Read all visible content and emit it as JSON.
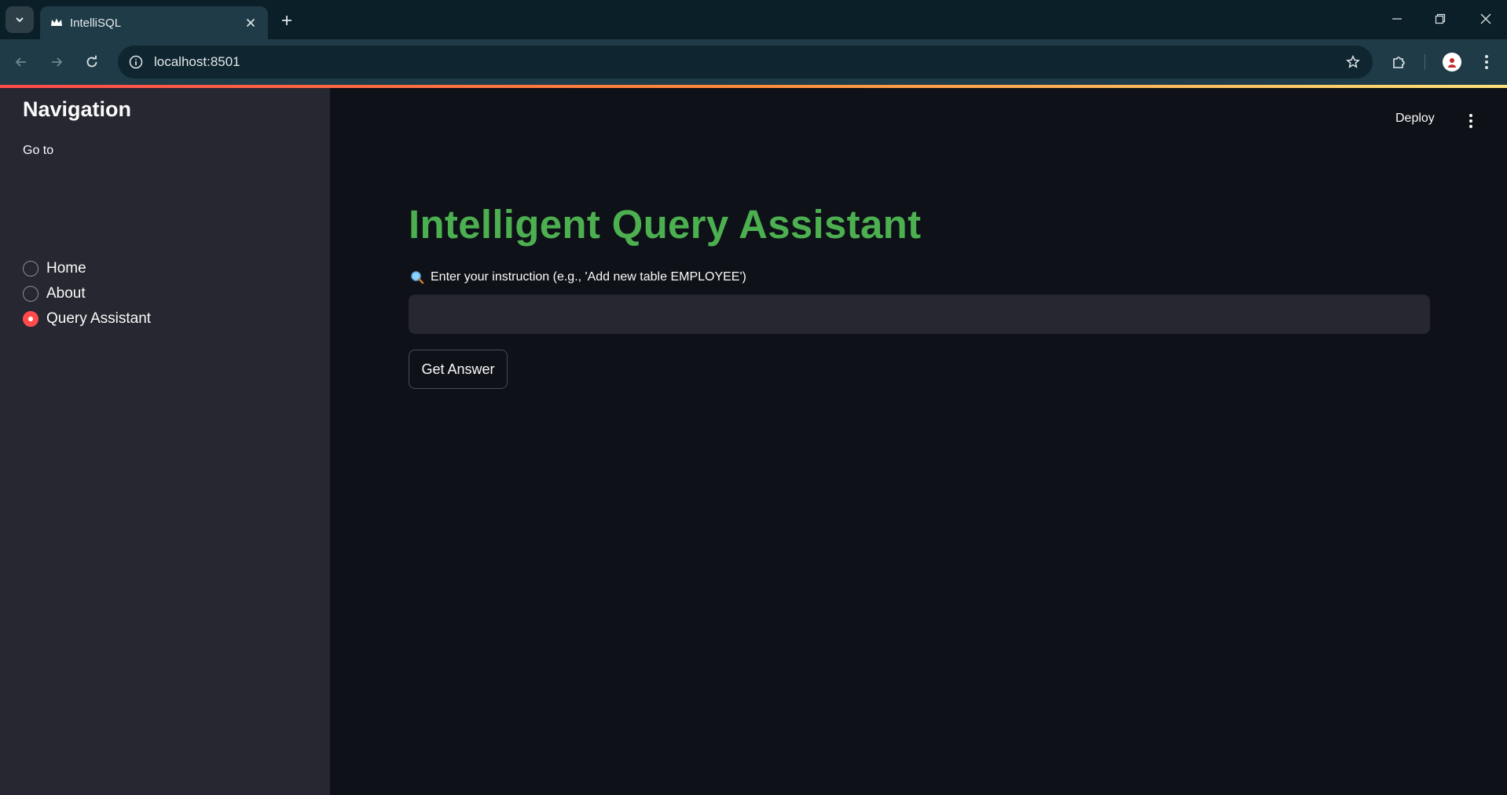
{
  "browser": {
    "tab_title": "IntelliSQL",
    "url": "localhost:8501"
  },
  "app": {
    "deploy_label": "Deploy",
    "sidebar": {
      "heading": "Navigation",
      "radio_label": "Go to",
      "options": [
        {
          "label": "Home",
          "selected": false
        },
        {
          "label": "About",
          "selected": false
        },
        {
          "label": "Query Assistant",
          "selected": true
        }
      ]
    },
    "main": {
      "title": "Intelligent Query Assistant",
      "input_label": "Enter your instruction (e.g., 'Add new table EMPLOYEE')",
      "input_value": "",
      "button_label": "Get Answer"
    }
  },
  "colors": {
    "title_green": "#4caf50",
    "accent_red": "#ff4b4b",
    "sidebar_bg": "#262730",
    "main_bg": "#0e1117"
  }
}
